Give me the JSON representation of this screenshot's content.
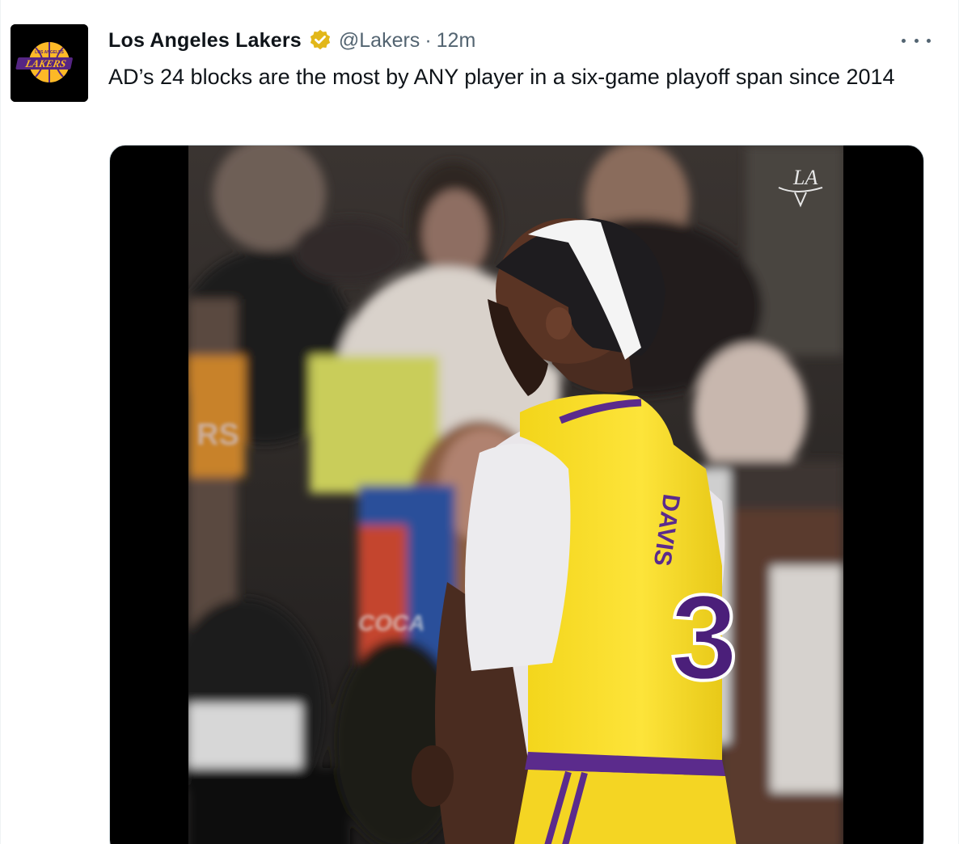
{
  "tweet": {
    "display_name": "Los Angeles Lakers",
    "verified_icon": "verified-gold-badge-icon",
    "handle": "@Lakers",
    "separator": "·",
    "time": "12m",
    "text": "AD’s 24 blocks are the most by ANY player in a six-game playoff span since 2014",
    "more_icon": "more-options-icon"
  },
  "avatar": {
    "logo_text": "LAKERS",
    "logo_small_text": "LOS ANGELES",
    "icon": "lakers-logo-icon"
  },
  "media": {
    "watermark": "LA",
    "jersey_name": "DAVIS",
    "jersey_number": "3",
    "crowd_sign": "RS",
    "crowd_shirt": "COCA"
  },
  "colors": {
    "lakers_gold": "#FDB927",
    "lakers_purple": "#552583",
    "verified_gold": "#E2B719",
    "text_primary": "#0f1419",
    "text_secondary": "#536471"
  }
}
